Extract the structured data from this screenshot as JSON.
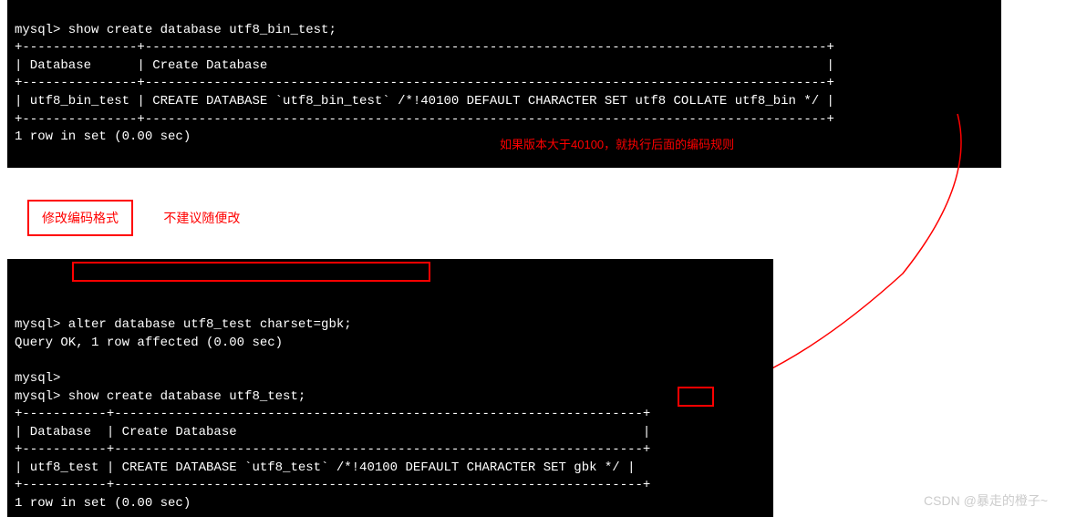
{
  "terminal1": {
    "line1": "mysql> show create database utf8_bin_test;",
    "sep1": "+---------------+-----------------------------------------------------------------------------------------+",
    "header": "| Database      | Create Database                                                                         |",
    "sep2": "+---------------+-----------------------------------------------------------------------------------------+",
    "row": "| utf8_bin_test | CREATE DATABASE `utf8_bin_test` /*!40100 DEFAULT CHARACTER SET utf8 COLLATE utf8_bin */ |",
    "sep3": "+---------------+-----------------------------------------------------------------------------------------+",
    "footer": "1 row in set (0.00 sec)"
  },
  "annotation1": "如果版本大于40100，就执行后面的编码规则",
  "labelBox": "修改编码格式",
  "labelText": "不建议随便改",
  "terminal2": {
    "line1": "mysql> alter database utf8_test charset=gbk;",
    "line2": "Query OK, 1 row affected (0.00 sec)",
    "blank": "",
    "line3": "mysql>",
    "line4": "mysql> show create database utf8_test;",
    "sep1": "+-----------+---------------------------------------------------------------------+",
    "header": "| Database  | Create Database                                                     |",
    "sep2": "+-----------+---------------------------------------------------------------------+",
    "row": "| utf8_test | CREATE DATABASE `utf8_test` /*!40100 DEFAULT CHARACTER SET gbk */ |",
    "sep3": "+-----------+---------------------------------------------------------------------+",
    "footer": "1 row in set (0.00 sec)"
  },
  "watermark": "CSDN @暴走的橙子~"
}
